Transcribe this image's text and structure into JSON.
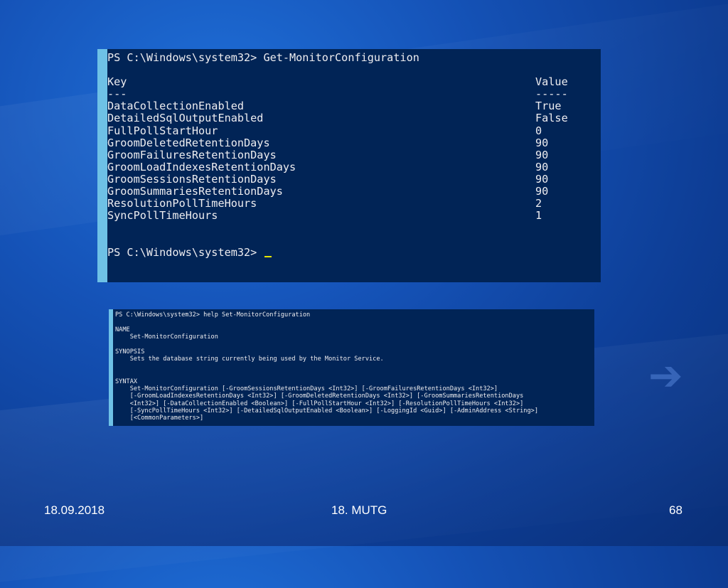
{
  "console1": {
    "prompt_command": "PS C:\\Windows\\system32> Get-MonitorConfiguration",
    "header": {
      "key": "Key",
      "value": "Value"
    },
    "divider": {
      "key": "---",
      "value": "-----"
    },
    "rows": [
      {
        "key": "DataCollectionEnabled",
        "value": "True"
      },
      {
        "key": "DetailedSqlOutputEnabled",
        "value": "False"
      },
      {
        "key": "FullPollStartHour",
        "value": "0"
      },
      {
        "key": "GroomDeletedRetentionDays",
        "value": "90"
      },
      {
        "key": "GroomFailuresRetentionDays",
        "value": "90"
      },
      {
        "key": "GroomLoadIndexesRetentionDays",
        "value": "90"
      },
      {
        "key": "GroomSessionsRetentionDays",
        "value": "90"
      },
      {
        "key": "GroomSummariesRetentionDays",
        "value": "90"
      },
      {
        "key": "ResolutionPollTimeHours",
        "value": "2"
      },
      {
        "key": "SyncPollTimeHours",
        "value": "1"
      }
    ],
    "prompt_end": "PS C:\\Windows\\system32> "
  },
  "console2": {
    "lines": [
      "PS C:\\Windows\\system32> help Set-MonitorConfiguration",
      "",
      "NAME",
      "    Set-MonitorConfiguration",
      "",
      "SYNOPSIS",
      "    Sets the database string currently being used by the Monitor Service.",
      "",
      "",
      "SYNTAX",
      "    Set-MonitorConfiguration [-GroomSessionsRetentionDays <Int32>] [-GroomFailuresRetentionDays <Int32>]",
      "    [-GroomLoadIndexesRetentionDays <Int32>] [-GroomDeletedRetentionDays <Int32>] [-GroomSummariesRetentionDays",
      "    <Int32>] [-DataCollectionEnabled <Boolean>] [-FullPollStartHour <Int32>] [-ResolutionPollTimeHours <Int32>]",
      "    [-SyncPollTimeHours <Int32>] [-DetailedSqlOutputEnabled <Boolean>] [-LoggingId <Guid>] [-AdminAddress <String>]",
      "    [<CommonParameters>]"
    ]
  },
  "footer": {
    "date": "18.09.2018",
    "title": "18. MUTG",
    "page": "68"
  },
  "icons": {
    "decor": "arrow-right-icon"
  },
  "colors": {
    "console_bg": "#012456",
    "console_text": "#eeedf0",
    "accent_bar": "#6ec1e6",
    "cursor": "#e6e600"
  }
}
